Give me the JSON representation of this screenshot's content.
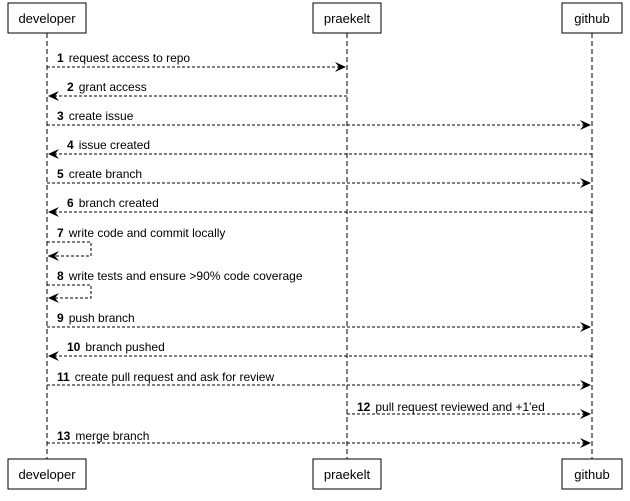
{
  "actors": [
    {
      "id": "developer",
      "label": "developer"
    },
    {
      "id": "praekelt",
      "label": "praekelt"
    },
    {
      "id": "github",
      "label": "github"
    }
  ],
  "messages": [
    {
      "num": "1",
      "text": "request access to repo",
      "from": "developer",
      "to": "praekelt"
    },
    {
      "num": "2",
      "text": "grant access",
      "from": "praekelt",
      "to": "developer"
    },
    {
      "num": "3",
      "text": "create issue",
      "from": "developer",
      "to": "github"
    },
    {
      "num": "4",
      "text": "issue created",
      "from": "github",
      "to": "developer"
    },
    {
      "num": "5",
      "text": "create branch",
      "from": "developer",
      "to": "github"
    },
    {
      "num": "6",
      "text": "branch created",
      "from": "github",
      "to": "developer"
    },
    {
      "num": "7",
      "text": "write code and commit locally",
      "from": "developer",
      "to": "developer"
    },
    {
      "num": "8",
      "text": "write tests and ensure >90% code coverage",
      "from": "developer",
      "to": "developer"
    },
    {
      "num": "9",
      "text": "push branch",
      "from": "developer",
      "to": "github"
    },
    {
      "num": "10",
      "text": "branch pushed",
      "from": "github",
      "to": "developer"
    },
    {
      "num": "11",
      "text": "create pull request and ask for review",
      "from": "developer",
      "to": "github"
    },
    {
      "num": "12",
      "text": "pull request reviewed and +1'ed",
      "from": "praekelt",
      "to": "github"
    },
    {
      "num": "13",
      "text": "merge branch",
      "from": "developer",
      "to": "github"
    }
  ]
}
